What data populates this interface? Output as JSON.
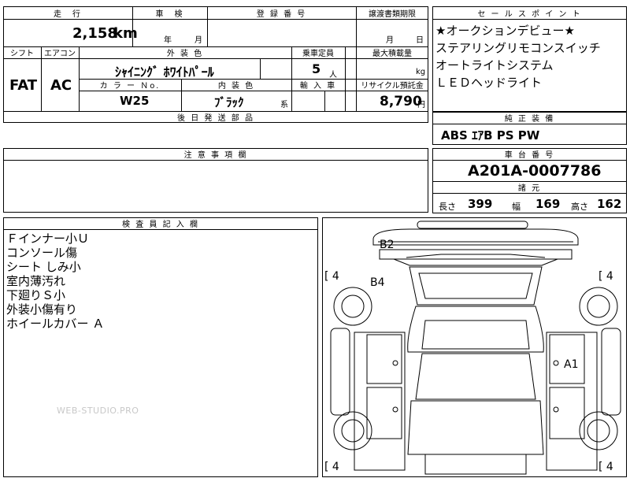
{
  "header": {
    "mileage_label": "走　行",
    "mileage_value": "2,158",
    "mileage_unit": "km",
    "inspection_label": "車　検",
    "inspection_year": "年",
    "inspection_month": "月",
    "registration_label": "登 録 番 号",
    "transfer_label": "譲渡書類期限",
    "transfer_month": "月",
    "transfer_day": "日"
  },
  "row2": {
    "shift_label": "シフト",
    "ac_label": "エアコン",
    "shift_value": "FAT",
    "ac_value": "AC",
    "exterior_label": "外 装 色",
    "exterior_value": "ｼｬｲﾆﾝｸﾞ ﾎﾜｲﾄﾊﾟｰﾙ",
    "capacity_label": "乗車定員",
    "capacity_value": "5",
    "capacity_unit": "人",
    "load_label": "最大積載量",
    "load_unit": "kg",
    "color_no_label": "カ ラ ー Ｎo.",
    "interior_label": "内 装 色",
    "import_label": "輸 入 車",
    "recycle_label": "リサイクル預託金",
    "color_no_value": "W25",
    "interior_value": "ﾌﾞﾗｯｸ",
    "interior_suffix": "系",
    "recycle_value": "8,790",
    "recycle_unit": "円",
    "parts_label": "後 日 発 送 部 品"
  },
  "sales_points": {
    "title": "セ ー ル ス ポ イ ン ト",
    "lines": [
      "★オークションデビュー★",
      "ステアリングリモコンスイッチ",
      "オートライトシステム",
      "ＬＥＤヘッドライト"
    ]
  },
  "equipment": {
    "title": "純 正 装 備",
    "value": "ABS ｴｱB PS PW"
  },
  "notes": {
    "title": "注 意 事 項 欄"
  },
  "chassis": {
    "title": "車 台 番 号",
    "value": "A201A-0007786",
    "specs_title": "諸 元",
    "length_label": "長さ",
    "length_value": "399",
    "width_label": "幅",
    "width_value": "169",
    "height_label": "高さ",
    "height_value": "162"
  },
  "inspector": {
    "title": "検 査 員 記 入 欄",
    "lines": [
      "Ｆインナー小Ｕ",
      "コンソール傷",
      "シート しみ小",
      "室内薄汚れ",
      "下廻りＳ小",
      "外装小傷有り",
      "ホイールカバー Ａ"
    ]
  },
  "diagram": {
    "b2": "B2",
    "b4": "B4",
    "a1": "A1",
    "tire_tl": "[ 4",
    "tire_tr": "[ 4",
    "tire_bl": "[ 4",
    "tire_br": "[ 4"
  },
  "watermark": "WEB-STUDIO.PRO"
}
